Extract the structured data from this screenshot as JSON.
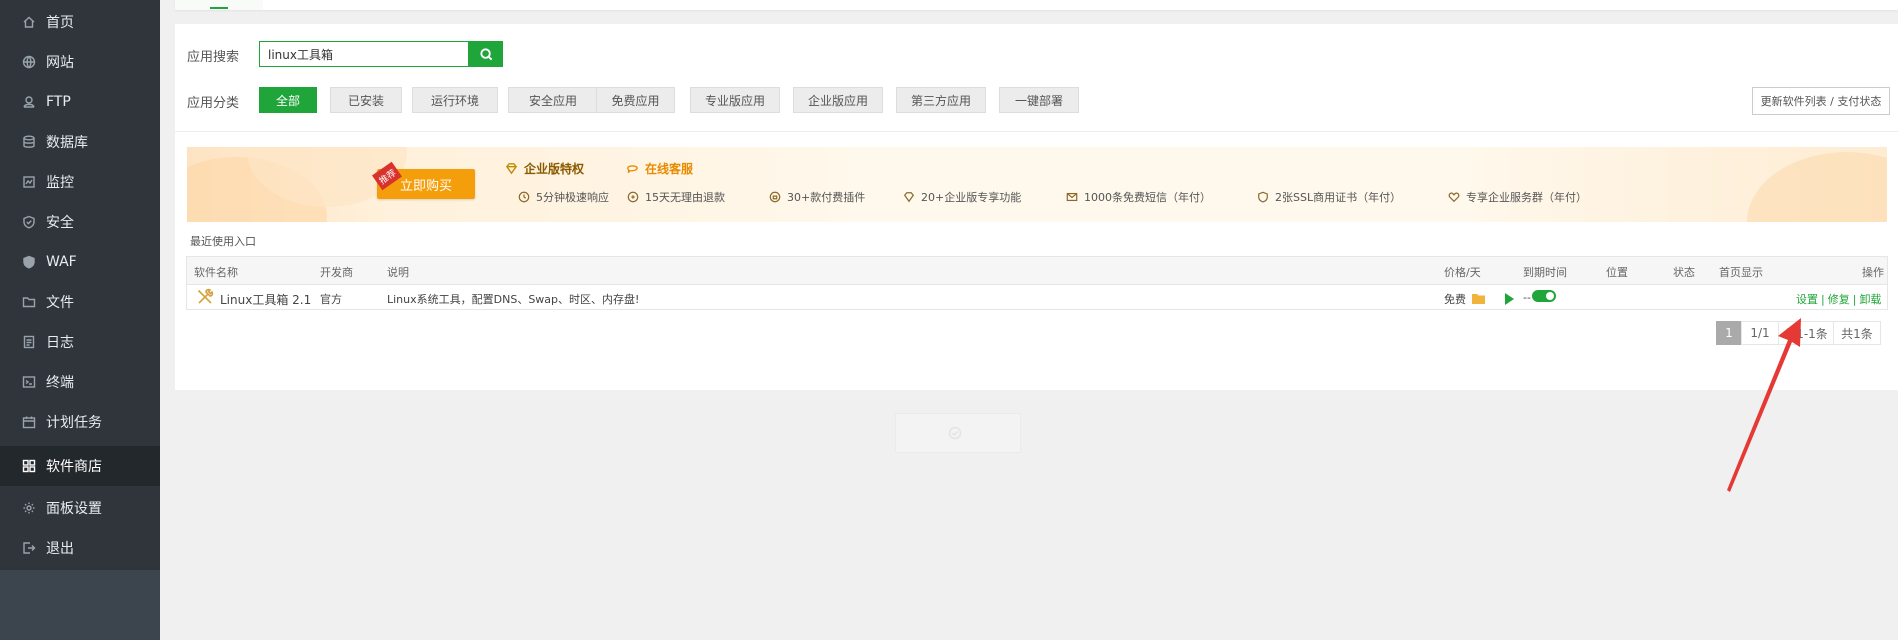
{
  "sidebar": {
    "items": [
      {
        "label": "首页",
        "icon": "home-icon"
      },
      {
        "label": "网站",
        "icon": "globe-icon"
      },
      {
        "label": "FTP",
        "icon": "ftp-icon"
      },
      {
        "label": "数据库",
        "icon": "database-icon"
      },
      {
        "label": "监控",
        "icon": "monitor-icon"
      },
      {
        "label": "安全",
        "icon": "shield-icon"
      },
      {
        "label": "WAF",
        "icon": "waf-shield-icon"
      },
      {
        "label": "文件",
        "icon": "folder-icon"
      },
      {
        "label": "日志",
        "icon": "log-icon"
      },
      {
        "label": "终端",
        "icon": "terminal-icon"
      },
      {
        "label": "计划任务",
        "icon": "calendar-icon"
      },
      {
        "label": "软件商店",
        "icon": "apps-grid-icon"
      },
      {
        "label": "面板设置",
        "icon": "gear-icon"
      },
      {
        "label": "退出",
        "icon": "logout-icon"
      }
    ],
    "active": "软件商店"
  },
  "search": {
    "label": "应用搜索",
    "value": "linux工具箱"
  },
  "categories": {
    "label": "应用分类",
    "items": [
      "全部",
      "已安装",
      "运行环境",
      "安全应用",
      "免费应用",
      "专业版应用",
      "企业版应用",
      "第三方应用",
      "一键部署"
    ],
    "active": "全部"
  },
  "update_button": "更新软件列表 / 支付状态",
  "banner": {
    "buy_button": "立即购买",
    "buy_tag": "推荐",
    "title": "企业版特权",
    "service": "在线客服",
    "features": [
      "5分钟极速响应",
      "15天无理由退款",
      "30+款付费插件",
      "20+企业版专享功能",
      "1000条免费短信（年付）",
      "2张SSL商用证书（年付）",
      "专享企业服务群（年付）"
    ]
  },
  "recent_label": "最近使用入口",
  "table": {
    "headers": [
      "软件名称",
      "开发商",
      "说明",
      "价格/天",
      "到期时间",
      "位置",
      "状态",
      "首页显示",
      "操作"
    ],
    "rows": [
      {
        "name": "Linux工具箱 2.1",
        "developer": "官方",
        "description": "Linux系统工具，配置DNS、Swap、时区、内存盘!",
        "price": "免费",
        "expire": "--",
        "ops": [
          "设置",
          "修复",
          "卸载"
        ],
        "home_display": true
      }
    ]
  },
  "pager": {
    "current": "1",
    "pages": "1/1",
    "range": "从1-1条",
    "total": "共1条"
  },
  "colors": {
    "accent": "#20a53a",
    "sidebar": "#2f353b",
    "annotation_arrow": "#e53935"
  }
}
